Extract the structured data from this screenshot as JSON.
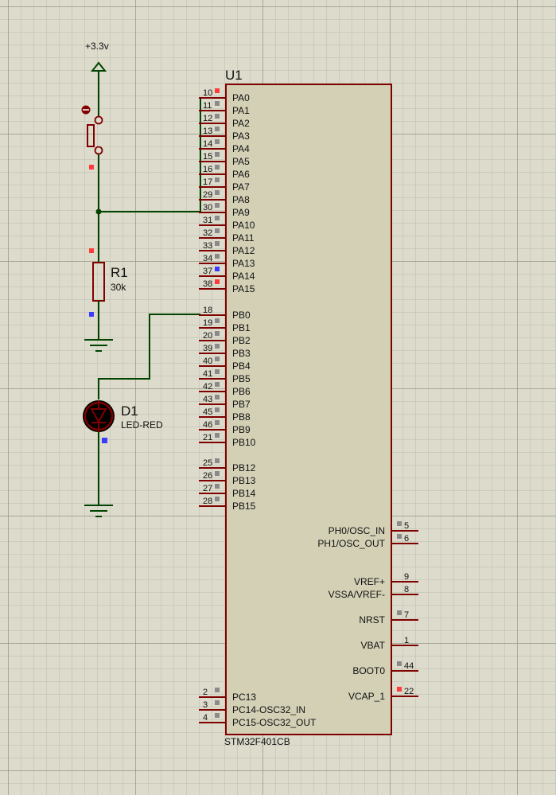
{
  "power": {
    "label": "+3.3v"
  },
  "mcu": {
    "ref": "U1",
    "part": "STM32F401CB",
    "left_pins": [
      {
        "num": "10",
        "name": "PA0",
        "state": "red"
      },
      {
        "num": "11",
        "name": "PA1",
        "state": "gray"
      },
      {
        "num": "12",
        "name": "PA2",
        "state": "gray"
      },
      {
        "num": "13",
        "name": "PA3",
        "state": "gray"
      },
      {
        "num": "14",
        "name": "PA4",
        "state": "gray"
      },
      {
        "num": "15",
        "name": "PA5",
        "state": "gray"
      },
      {
        "num": "16",
        "name": "PA6",
        "state": "gray"
      },
      {
        "num": "17",
        "name": "PA7",
        "state": "gray"
      },
      {
        "num": "29",
        "name": "PA8",
        "state": "gray"
      },
      {
        "num": "30",
        "name": "PA9",
        "state": "gray"
      },
      {
        "num": "31",
        "name": "PA10",
        "state": "gray"
      },
      {
        "num": "32",
        "name": "PA11",
        "state": "gray"
      },
      {
        "num": "33",
        "name": "PA12",
        "state": "gray"
      },
      {
        "num": "34",
        "name": "PA13",
        "state": "gray"
      },
      {
        "num": "37",
        "name": "PA14",
        "state": "blue"
      },
      {
        "num": "38",
        "name": "PA15",
        "state": "red"
      },
      {
        "num": "18",
        "name": "PB0",
        "state": "none"
      },
      {
        "num": "19",
        "name": "PB1",
        "state": "gray"
      },
      {
        "num": "20",
        "name": "PB2",
        "state": "gray"
      },
      {
        "num": "39",
        "name": "PB3",
        "state": "gray"
      },
      {
        "num": "40",
        "name": "PB4",
        "state": "gray"
      },
      {
        "num": "41",
        "name": "PB5",
        "state": "gray"
      },
      {
        "num": "42",
        "name": "PB6",
        "state": "gray"
      },
      {
        "num": "43",
        "name": "PB7",
        "state": "gray"
      },
      {
        "num": "45",
        "name": "PB8",
        "state": "gray"
      },
      {
        "num": "46",
        "name": "PB9",
        "state": "gray"
      },
      {
        "num": "21",
        "name": "PB10",
        "state": "gray"
      },
      {
        "num": "25",
        "name": "PB12",
        "state": "gray"
      },
      {
        "num": "26",
        "name": "PB13",
        "state": "gray"
      },
      {
        "num": "27",
        "name": "PB14",
        "state": "gray"
      },
      {
        "num": "28",
        "name": "PB15",
        "state": "gray"
      },
      {
        "num": "2",
        "name": "PC13",
        "state": "gray"
      },
      {
        "num": "3",
        "name": "PC14-OSC32_IN",
        "state": "gray"
      },
      {
        "num": "4",
        "name": "PC15-OSC32_OUT",
        "state": "gray"
      }
    ],
    "right_pins": [
      {
        "num": "5",
        "name": "PH0/OSC_IN",
        "state": "gray"
      },
      {
        "num": "6",
        "name": "PH1/OSC_OUT",
        "state": "gray"
      },
      {
        "num": "9",
        "name": "VREF+",
        "state": "none"
      },
      {
        "num": "8",
        "name": "VSSA/VREF-",
        "state": "none"
      },
      {
        "num": "7",
        "name": "NRST",
        "state": "gray"
      },
      {
        "num": "1",
        "name": "VBAT",
        "state": "none"
      },
      {
        "num": "44",
        "name": "BOOT0",
        "state": "gray"
      },
      {
        "num": "22",
        "name": "VCAP_1",
        "state": "red"
      }
    ]
  },
  "resistor": {
    "ref": "R1",
    "value": "30k"
  },
  "led": {
    "ref": "D1",
    "value": "LED-RED"
  },
  "colors": {
    "wire": "#004400",
    "component": "#800000",
    "chip_fill": "#d3d0b6",
    "state_red": "#ff3b3b",
    "state_blue": "#3b3bff",
    "state_gray": "#8a8a8a"
  }
}
